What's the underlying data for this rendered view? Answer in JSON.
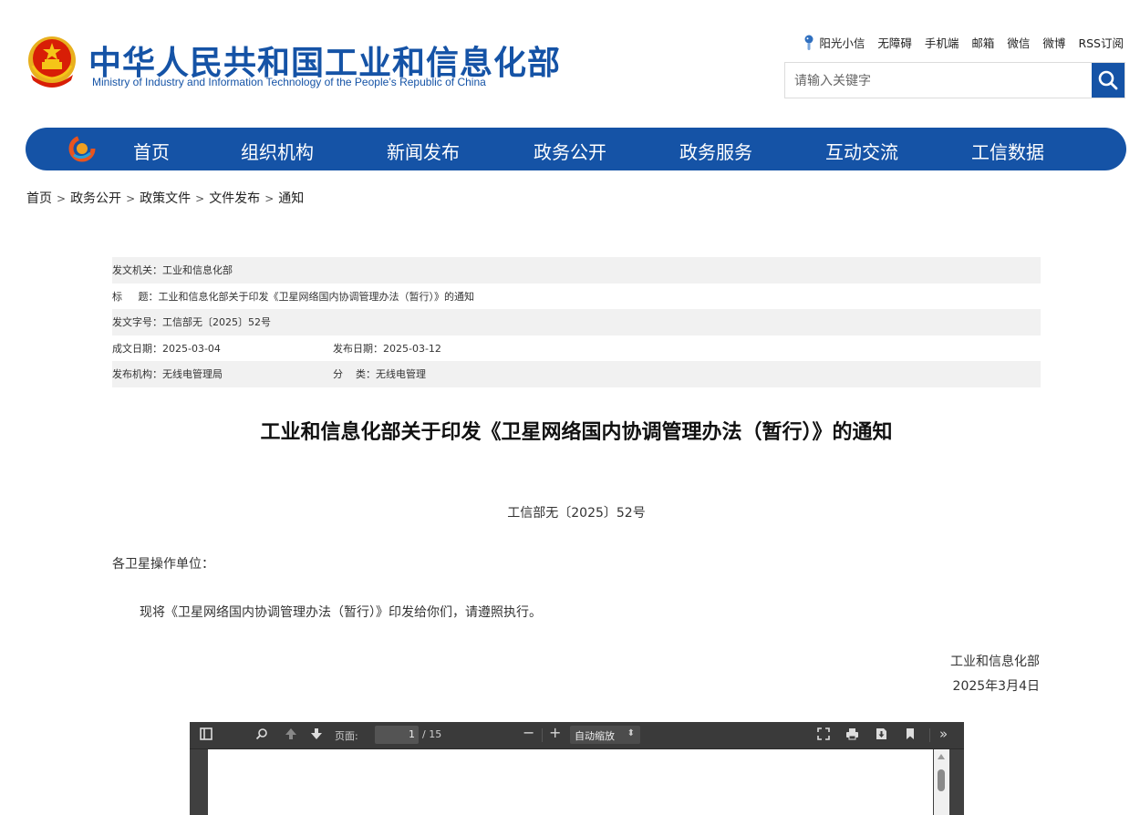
{
  "header": {
    "title": "中华人民共和国工业和信息化部",
    "subtitle": "Ministry of Industry and Information Technology of the People’s Republic of China",
    "emblem_icon": "national-emblem-icon",
    "toplinks": [
      "阳光小信",
      "无障碍",
      "手机端",
      "邮箱",
      "微信",
      "微博",
      "RSS订阅"
    ],
    "search_placeholder": "请输入关键字",
    "accent": "#1553a6"
  },
  "nav": {
    "items": [
      "首页",
      "组织机构",
      "新闻发布",
      "政务公开",
      "政务服务",
      "互动交流",
      "工信数据"
    ]
  },
  "breadcrumb": {
    "items": [
      "首页",
      "政务公开",
      "政策文件",
      "文件发布",
      "通知"
    ],
    "separator": ">"
  },
  "meta": {
    "issuer": "发文机关：工业和信息化部",
    "title": "标     题：工业和信息化部关于印发《卫星网络国内协调管理办法（暂行）》的通知",
    "doc_number": "发文字号：工信部无〔2025〕52号",
    "written_date": "成文日期：2025-03-04",
    "publish_date": "发布日期：2025-03-12",
    "publishing_org": "发布机构：无线电管理局",
    "category": "分    类：无线电管理"
  },
  "document": {
    "title": "工业和信息化部关于印发《卫星网络国内协调管理办法（暂行）》的通知",
    "doc_number": "工信部无〔2025〕52号",
    "addressee": "各卫星操作单位：",
    "body": "现将《卫星网络国内协调管理办法（暂行）》印发给你们，请遵照执行。",
    "signature_org": "工业和信息化部",
    "signature_date": "2025年3月4日"
  },
  "pdf_viewer": {
    "page_label": "页面:",
    "current_page": "1",
    "total_pages": "/ 15",
    "zoom": "自动缩放"
  }
}
